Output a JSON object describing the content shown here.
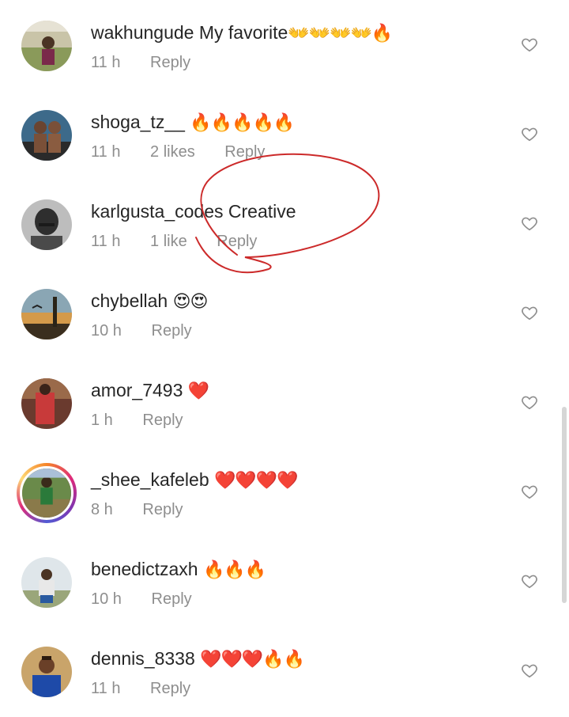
{
  "colors": {
    "text": "#262626",
    "meta": "#8e8e8e",
    "annotation": "#cc2a2a"
  },
  "comments": [
    {
      "username": "wakhungude",
      "text": "My favorite",
      "emoji": "👐👐👐👐🔥",
      "time": "11 h",
      "likes": "",
      "reply": "Reply",
      "avatar": "bush-scene"
    },
    {
      "username": "shoga_tz__",
      "text": "",
      "emoji": "🔥🔥🔥🔥🔥",
      "time": "11 h",
      "likes": "2 likes",
      "reply": "Reply",
      "avatar": "two-people"
    },
    {
      "username": "karlgusta_codes",
      "text": "Creative",
      "emoji": "",
      "time": "11 h",
      "likes": "1 like",
      "reply": "Reply",
      "avatar": "grayscale-portrait"
    },
    {
      "username": "chybellah",
      "text": "",
      "emoji": "😍😍",
      "time": "10 h",
      "likes": "",
      "reply": "Reply",
      "avatar": "sunset-tower"
    },
    {
      "username": "amor_7493",
      "text": "",
      "emoji": "❤️",
      "time": "1 h",
      "likes": "",
      "reply": "Reply",
      "avatar": "red-outfit"
    },
    {
      "username": "_shee_kafeleb",
      "text": "",
      "emoji": "❤️❤️❤️❤️",
      "time": "8 h",
      "likes": "",
      "reply": "Reply",
      "avatar": "green-outdoor",
      "story": true
    },
    {
      "username": "benedictzaxh",
      "text": "",
      "emoji": "🔥🔥🔥",
      "time": "10 h",
      "likes": "",
      "reply": "Reply",
      "avatar": "sitting-person"
    },
    {
      "username": "dennis_8338",
      "text": "",
      "emoji": "❤️❤️❤️🔥🔥",
      "time": "11 h",
      "likes": "",
      "reply": "Reply",
      "avatar": "man-in-blue"
    }
  ],
  "icons": {
    "like": "heart-outline-icon"
  }
}
